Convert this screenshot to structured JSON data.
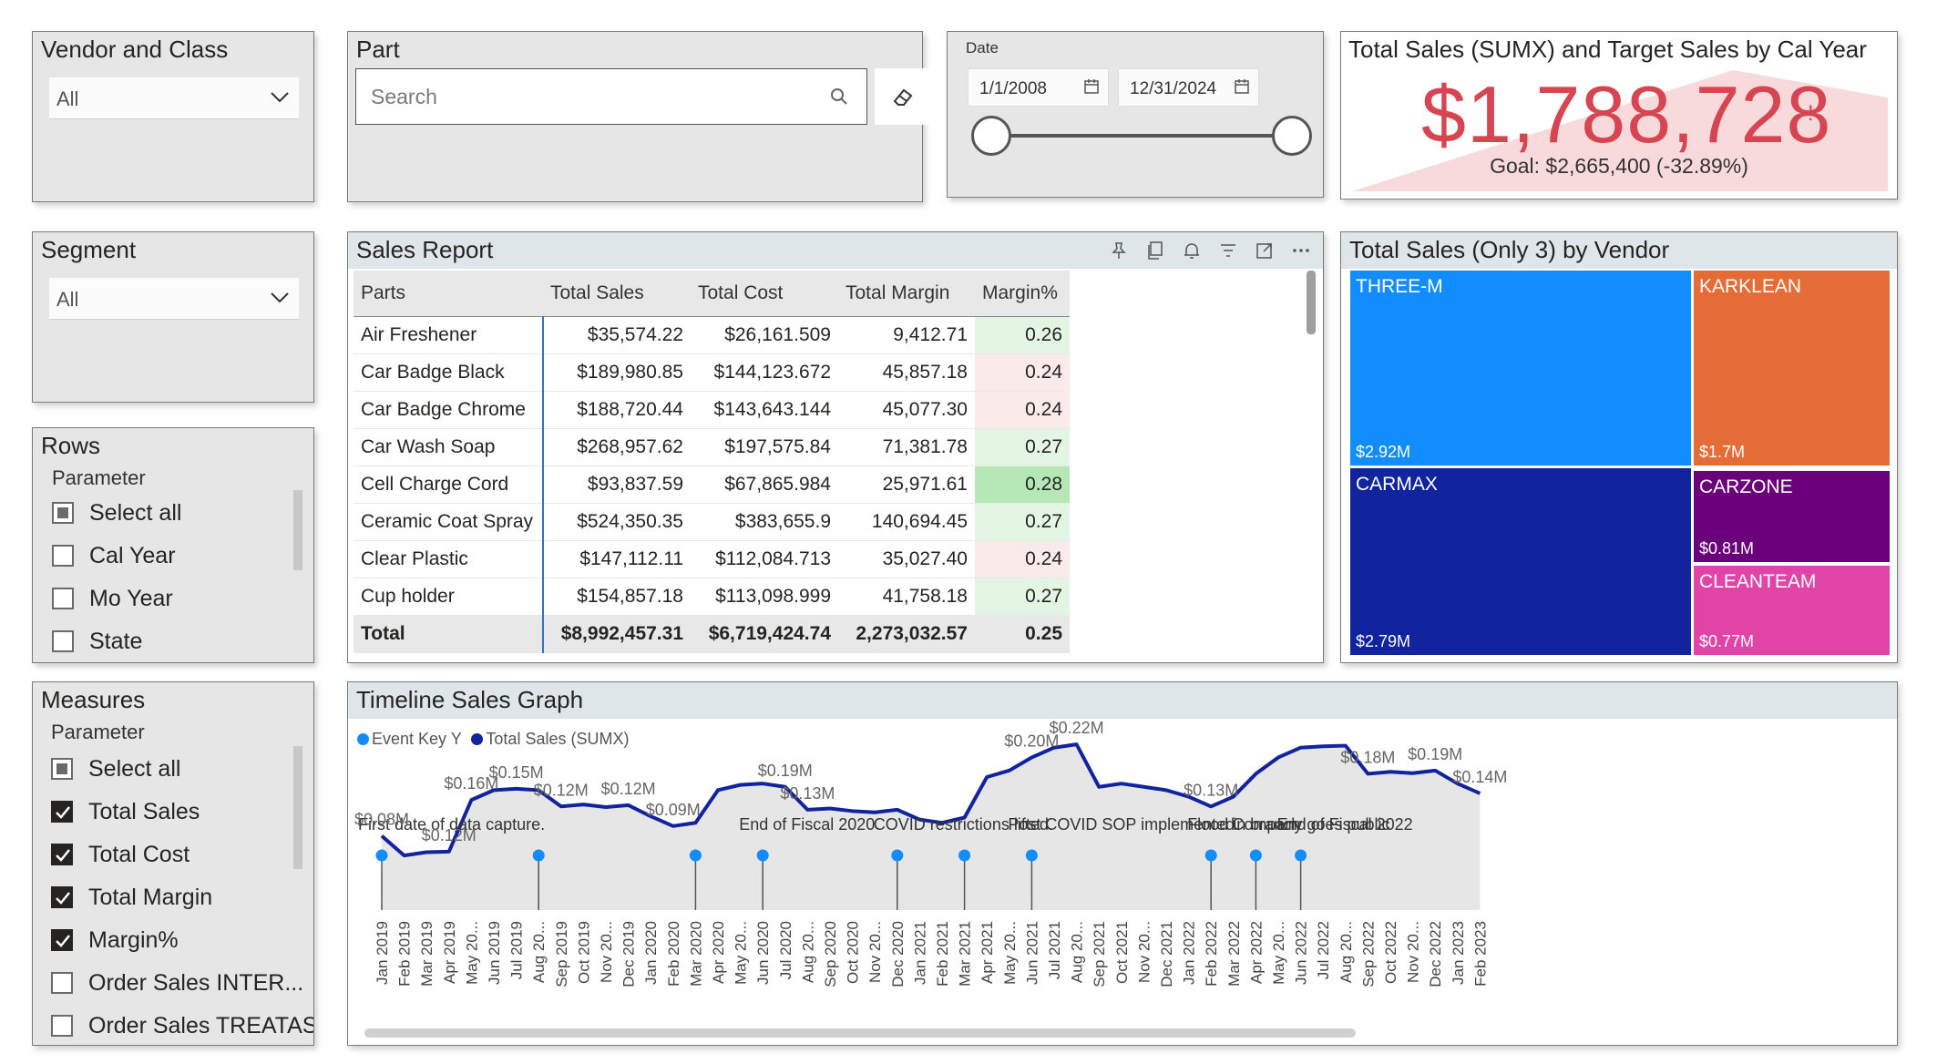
{
  "vendor_class": {
    "title": "Vendor and Class",
    "value": "All"
  },
  "part": {
    "title": "Part",
    "search_placeholder": "Search"
  },
  "date": {
    "label": "Date",
    "start": "1/1/2008",
    "end": "12/31/2024"
  },
  "kpi": {
    "title": "Total Sales (SUMX) and Target Sales by Cal Year",
    "value": "$1,788,728",
    "indicator": "!",
    "goal": "Goal: $2,665,400 (-32.89%)",
    "status_color": "#d64550"
  },
  "segment": {
    "title": "Segment",
    "value": "All"
  },
  "rows": {
    "title": "Rows",
    "parameter_label": "Parameter",
    "options": [
      {
        "label": "Select all",
        "state": "partial"
      },
      {
        "label": "Cal Year",
        "state": "unchecked"
      },
      {
        "label": "Mo Year",
        "state": "unchecked"
      },
      {
        "label": "State",
        "state": "unchecked"
      }
    ]
  },
  "measures": {
    "title": "Measures",
    "parameter_label": "Parameter",
    "options": [
      {
        "label": "Select all",
        "state": "partial"
      },
      {
        "label": "Total Sales",
        "state": "checked"
      },
      {
        "label": "Total Cost",
        "state": "checked"
      },
      {
        "label": "Total Margin",
        "state": "checked"
      },
      {
        "label": "Margin%",
        "state": "checked"
      },
      {
        "label": "Order Sales INTER...",
        "state": "unchecked"
      },
      {
        "label": "Order Sales TREATAS",
        "state": "unchecked"
      }
    ]
  },
  "sales_report": {
    "title": "Sales Report",
    "toolbar_icons": [
      "pin-icon",
      "copy-icon",
      "bell-icon",
      "filter-icon",
      "focus-mode-icon",
      "more-options-icon"
    ],
    "columns": [
      "Parts",
      "Total Sales",
      "Total Cost",
      "Total Margin",
      "Margin%"
    ],
    "rows": [
      [
        "Air Freshener",
        "$35,574.22",
        "$26,161.509",
        "9,412.71",
        "0.26"
      ],
      [
        "Car Badge Black",
        "$189,980.85",
        "$144,123.672",
        "45,857.18",
        "0.24"
      ],
      [
        "Car Badge Chrome",
        "$188,720.44",
        "$143,643.144",
        "45,077.30",
        "0.24"
      ],
      [
        "Car Wash Soap",
        "$268,957.62",
        "$197,575.84",
        "71,381.78",
        "0.27"
      ],
      [
        "Cell Charge Cord",
        "$93,837.59",
        "$67,865.984",
        "25,971.61",
        "0.28"
      ],
      [
        "Ceramic Coat Spray",
        "$524,350.35",
        "$383,655.9",
        "140,694.45",
        "0.27"
      ],
      [
        "Clear Plastic",
        "$147,112.11",
        "$112,084.713",
        "35,027.40",
        "0.24"
      ],
      [
        "Cup holder",
        "$154,857.18",
        "$113,098.999",
        "41,758.18",
        "0.27"
      ]
    ],
    "margin_colors": [
      "#e3f5e3",
      "#fbeaea",
      "#fbeaea",
      "#e3f5e3",
      "#b5e8b5",
      "#e3f5e3",
      "#fbeaea",
      "#e3f5e3"
    ],
    "total": [
      "Total",
      "$8,992,457.31",
      "$6,719,424.74",
      "2,273,032.57",
      "0.25"
    ]
  },
  "treemap": {
    "title": "Total Sales (Only 3) by Vendor",
    "tiles": [
      {
        "name": "THREE-M",
        "value": "$2.92M",
        "color": "#118dff"
      },
      {
        "name": "KARKLEAN",
        "value": "$1.7M",
        "color": "#e66c37"
      },
      {
        "name": "CARMAX",
        "value": "$2.79M",
        "color": "#12239e"
      },
      {
        "name": "CARZONE",
        "value": "$0.81M",
        "color": "#6b007b"
      },
      {
        "name": "CLEANTEAM",
        "value": "$0.77M",
        "color": "#e044a7"
      }
    ]
  },
  "timeline": {
    "title": "Timeline Sales Graph",
    "legend": [
      {
        "name": "Event Key Y",
        "color": "#118dff"
      },
      {
        "name": "Total Sales (SUMX)",
        "color": "#12239e"
      }
    ]
  },
  "chart_data": {
    "type": "line",
    "x": [
      "Jan 2019",
      "Feb 2019",
      "Mar 2019",
      "Apr 2019",
      "May 20...",
      "Jun 2019",
      "Jul 2019",
      "Aug 20...",
      "Sep 2019",
      "Oct 2019",
      "Nov 20...",
      "Dec 2019",
      "Jan 2020",
      "Feb 2020",
      "Mar 2020",
      "Apr 2020",
      "May 20...",
      "Jun 2020",
      "Jul 2020",
      "Aug 20...",
      "Sep 2020",
      "Oct 2020",
      "Nov 20...",
      "Dec 2020",
      "Jan 2021",
      "Feb 2021",
      "Mar 2021",
      "Apr 2021",
      "May 20...",
      "Jun 2021",
      "Jul 2021",
      "Aug 20...",
      "Sep 2021",
      "Oct 2021",
      "Nov 20...",
      "Dec 2021",
      "Jan 2022",
      "Feb 2022",
      "Mar 2022",
      "Apr 2022",
      "May 20...",
      "Jun 2022",
      "Jul 2022",
      "Aug 20...",
      "Sep 2022",
      "Oct 2022",
      "Nov 20...",
      "Dec 2022",
      "Jan 2023",
      "Feb 2023"
    ],
    "series": [
      {
        "name": "Total Sales (SUMX)",
        "values": [
          0.08,
          0.05,
          0.055,
          0.056,
          0.135,
          0.15,
          0.152,
          0.15,
          0.125,
          0.128,
          0.124,
          0.127,
          0.11,
          0.095,
          0.1,
          0.15,
          0.158,
          0.16,
          0.155,
          0.12,
          0.122,
          0.118,
          0.116,
          0.12,
          0.105,
          0.1,
          0.108,
          0.17,
          0.18,
          0.2,
          0.215,
          0.22,
          0.155,
          0.16,
          0.155,
          0.15,
          0.14,
          0.125,
          0.14,
          0.175,
          0.2,
          0.215,
          0.217,
          0.218,
          0.175,
          0.178,
          0.176,
          0.18,
          0.16,
          0.145
        ]
      }
    ],
    "data_labels": [
      {
        "x": "Jan 2019",
        "text": "$0.08M"
      },
      {
        "x": "Apr 2019",
        "text": "$0.12M"
      },
      {
        "x": "Jul 2019",
        "text": "$0.15M"
      },
      {
        "x": "Sep 2019",
        "text": "$0.12M"
      },
      {
        "x": "Dec 2019",
        "text": "$0.12M"
      },
      {
        "x": "Feb 2020",
        "text": "$0.09M"
      },
      {
        "x": "May 20...",
        "text": "$0.16M"
      },
      {
        "x": "Jul 2020",
        "text": "$0.19M"
      },
      {
        "x": "Aug 20...",
        "text": "$0.13M"
      },
      {
        "x": "Jun 2021",
        "text": "$0.20M"
      },
      {
        "x": "Aug 20...",
        "text": "$0.22M"
      },
      {
        "x": "Feb 2022",
        "text": "$0.13M"
      },
      {
        "x": "Sep 2022",
        "text": "$0.18M"
      },
      {
        "x": "Dec 2022",
        "text": "$0.19M"
      },
      {
        "x": "Feb 2023",
        "text": "$0.14M"
      }
    ],
    "events": [
      {
        "x": "Jan 2019",
        "text": "First date of data capture."
      },
      {
        "x": "Mar 2020",
        "text": ""
      },
      {
        "x": "Jun 2020",
        "text": "End of Fiscal 2020"
      },
      {
        "x": "Dec 2020",
        "text": "COVID restrictions lifted"
      },
      {
        "x": "Mar 2021",
        "text": ""
      },
      {
        "x": "Jun 2021",
        "text": "Post COVID SOP implemented"
      },
      {
        "x": "Aug 20...",
        "text": ""
      },
      {
        "x": "Feb 2022",
        "text": "Flood in branch"
      },
      {
        "x": "Apr 2022",
        "text": "Company goes public"
      },
      {
        "x": "Jun 2022",
        "text": "End of Fiscal 2022"
      }
    ],
    "ylim": [
      0,
      0.25
    ],
    "grid": false,
    "legend_position": "top-left"
  }
}
